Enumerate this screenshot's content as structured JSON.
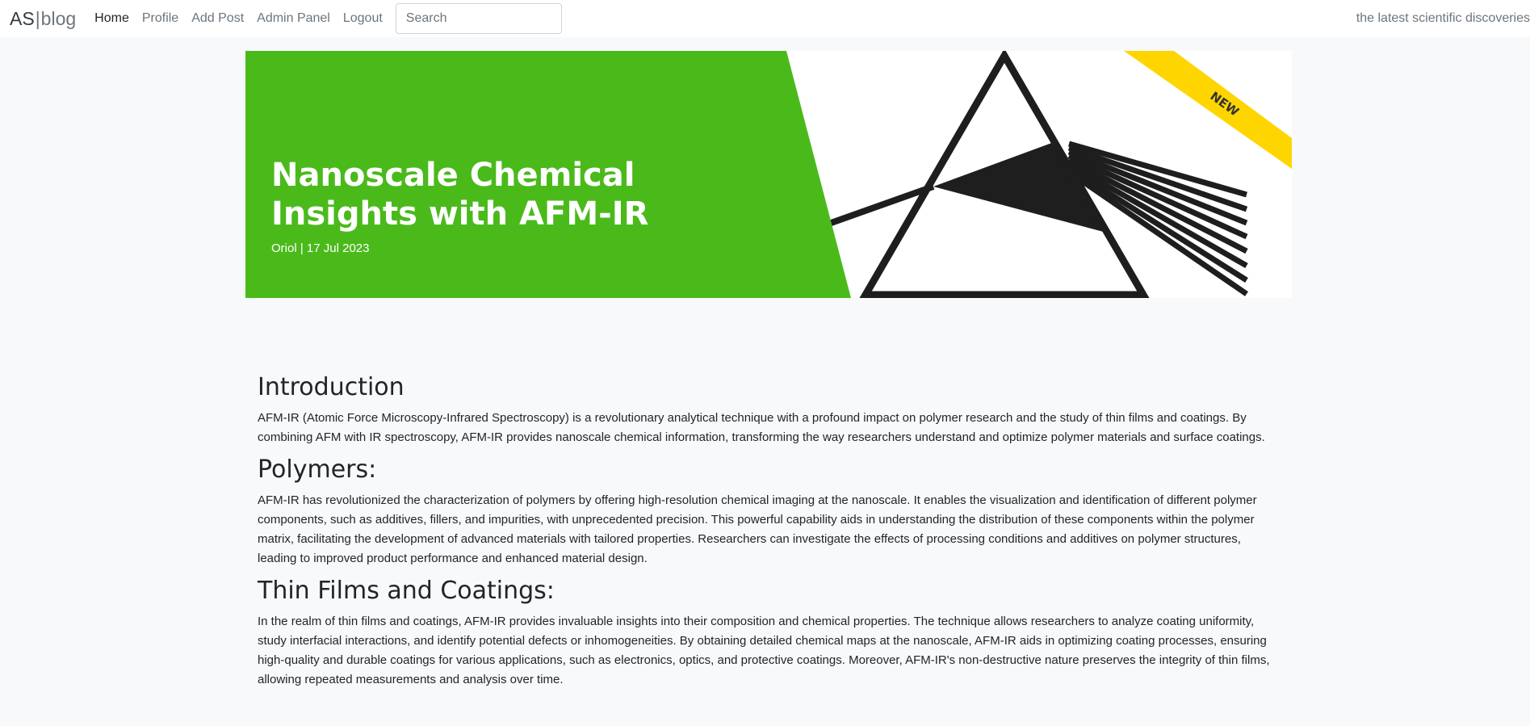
{
  "navbar": {
    "brand_strong": "AS",
    "brand_sep": "|",
    "brand_light": "blog",
    "links": [
      "Home",
      "Profile",
      "Add Post",
      "Admin Panel",
      "Logout"
    ],
    "search_placeholder": "Search",
    "tagline": "the latest scientific discoveries"
  },
  "hero": {
    "title": "Nanoscale Chemical Insights with AFM-IR",
    "meta": "Oriol | 17 Jul 2023",
    "badge": "NEW",
    "accent_color": "#4aba1b",
    "ribbon_color": "#ffd500"
  },
  "article": {
    "sections": [
      {
        "heading": "Introduction",
        "body": "AFM-IR (Atomic Force Microscopy-Infrared Spectroscopy) is a revolutionary analytical technique with a profound impact on polymer research and the study of thin films and coatings. By combining AFM with IR spectroscopy, AFM-IR provides nanoscale chemical information, transforming the way researchers understand and optimize polymer materials and surface coatings."
      },
      {
        "heading": "Polymers:",
        "body": "AFM-IR has revolutionized the characterization of polymers by offering high-resolution chemical imaging at the nanoscale. It enables the visualization and identification of different polymer components, such as additives, fillers, and impurities, with unprecedented precision. This powerful capability aids in understanding the distribution of these components within the polymer matrix, facilitating the development of advanced materials with tailored properties. Researchers can investigate the effects of processing conditions and additives on polymer structures, leading to improved product performance and enhanced material design."
      },
      {
        "heading": "Thin Films and Coatings:",
        "body": "In the realm of thin films and coatings, AFM-IR provides invaluable insights into their composition and chemical properties. The technique allows researchers to analyze coating uniformity, study interfacial interactions, and identify potential defects or inhomogeneities. By obtaining detailed chemical maps at the nanoscale, AFM-IR aids in optimizing coating processes, ensuring high-quality and durable coatings for various applications, such as electronics, optics, and protective coatings. Moreover, AFM-IR's non-destructive nature preserves the integrity of thin films, allowing repeated measurements and analysis over time."
      }
    ]
  }
}
